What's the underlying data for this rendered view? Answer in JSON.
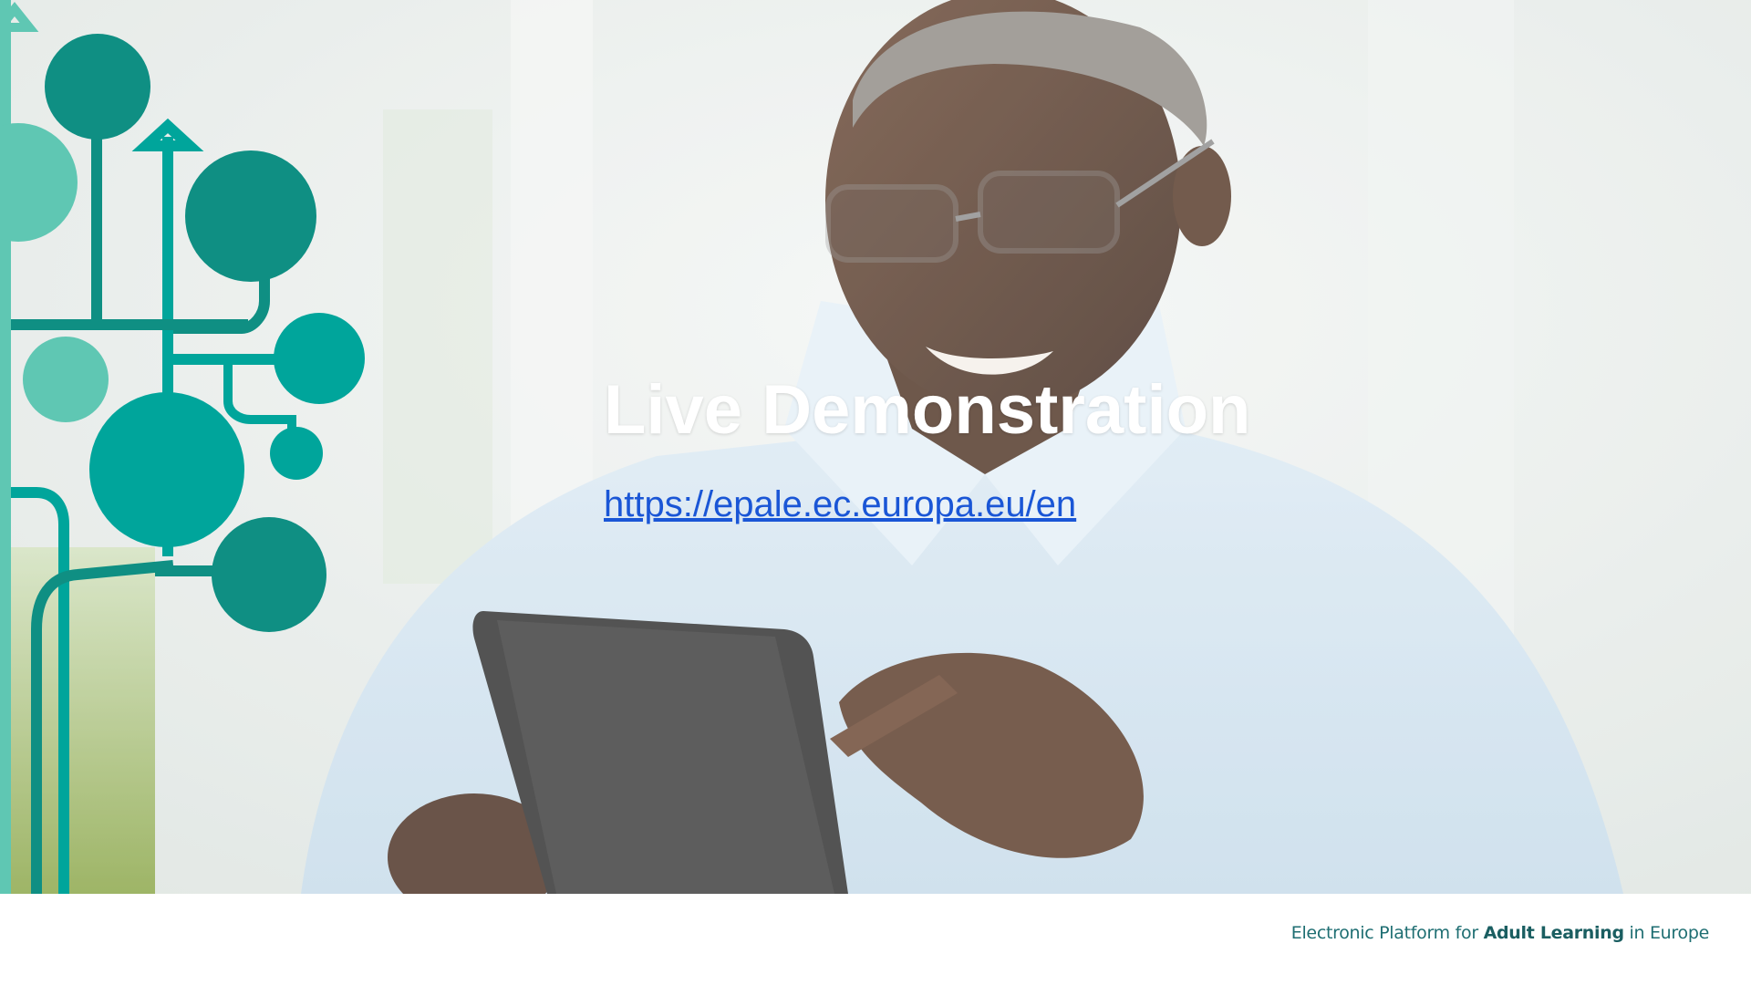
{
  "slide": {
    "title": "Live Demonstration",
    "link_text": "https://epale.ec.europa.eu/en",
    "photo": "senior-man-using-tablet-photo"
  },
  "footer": {
    "tagline_prefix": "Electronic Platform for ",
    "tagline_bold": "Adult Learning",
    "tagline_suffix": " in Europe"
  },
  "colors": {
    "accent_teal": "#00a59b",
    "accent_dark_teal": "#0f8f83",
    "accent_light_teal": "#5fc7b3",
    "link_blue": "#1a56d6",
    "title_white": "#ffffff"
  }
}
